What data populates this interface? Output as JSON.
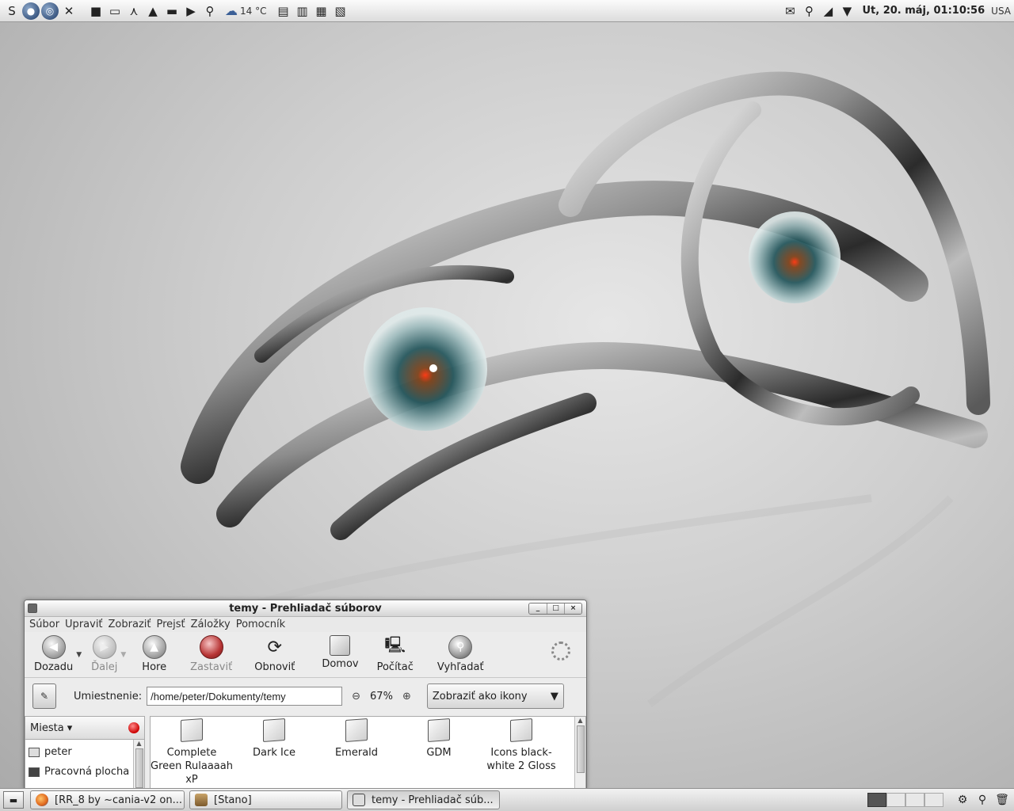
{
  "top_panel": {
    "launcher_icons": [
      "menu-icon",
      "globe-icon",
      "lifebuoy-icon",
      "tools-icon",
      "terminal-icon",
      "notebook-icon",
      "windmill-icon",
      "lighthouse-icon",
      "screen-icon",
      "play-icon",
      "wrench-icon"
    ],
    "weather": {
      "temperature": "14 °C",
      "icon": "rain-cloud-icon"
    },
    "window_icons": [
      "window-1-icon",
      "window-2-icon",
      "window-3-icon",
      "window-4-icon"
    ],
    "tray_icons": [
      "notes-icon",
      "search-icon",
      "network-icon",
      "monitor-icon"
    ],
    "clock": "Ut, 20. máj, 01:10:56",
    "keyboard_layout": "USA"
  },
  "file_manager": {
    "title": "temy - Prehliadač súborov",
    "window_buttons": [
      "_",
      "□",
      "×"
    ],
    "menu": [
      "Súbor",
      "Upraviť",
      "Zobraziť",
      "Prejsť",
      "Záložky",
      "Pomocník"
    ],
    "toolbar": {
      "back": "Dozadu",
      "forward": "Ďalej",
      "up": "Hore",
      "stop": "Zastaviť",
      "reload": "Obnoviť",
      "home": "Domov",
      "computer": "Počítač",
      "search": "Vyhľadať"
    },
    "location": {
      "label": "Umiestnenie:",
      "value": "/home/peter/Dokumenty/temy",
      "zoom": "67%",
      "view_mode": "Zobraziť ako ikony"
    },
    "sidebar": {
      "title": "Miesta",
      "items": [
        "peter",
        "Pracovná plocha"
      ]
    },
    "files": [
      {
        "name": "Complete Green Rulaaaah xP"
      },
      {
        "name": "Dark Ice"
      },
      {
        "name": "Emerald"
      },
      {
        "name": "GDM"
      },
      {
        "name": "Icons black-white 2 Gloss"
      }
    ]
  },
  "taskbar": {
    "tasks": [
      {
        "label": "[RR_8 by ~cania-v2 on...",
        "icon": "firefox-icon",
        "active": false
      },
      {
        "label": "[Stano]",
        "icon": "image-viewer-icon",
        "active": false
      },
      {
        "label": "temy - Prehliadač súb...",
        "icon": "file-manager-icon",
        "active": true
      }
    ],
    "tray_icons": [
      "update-icon",
      "search-icon",
      "trash-icon"
    ]
  }
}
